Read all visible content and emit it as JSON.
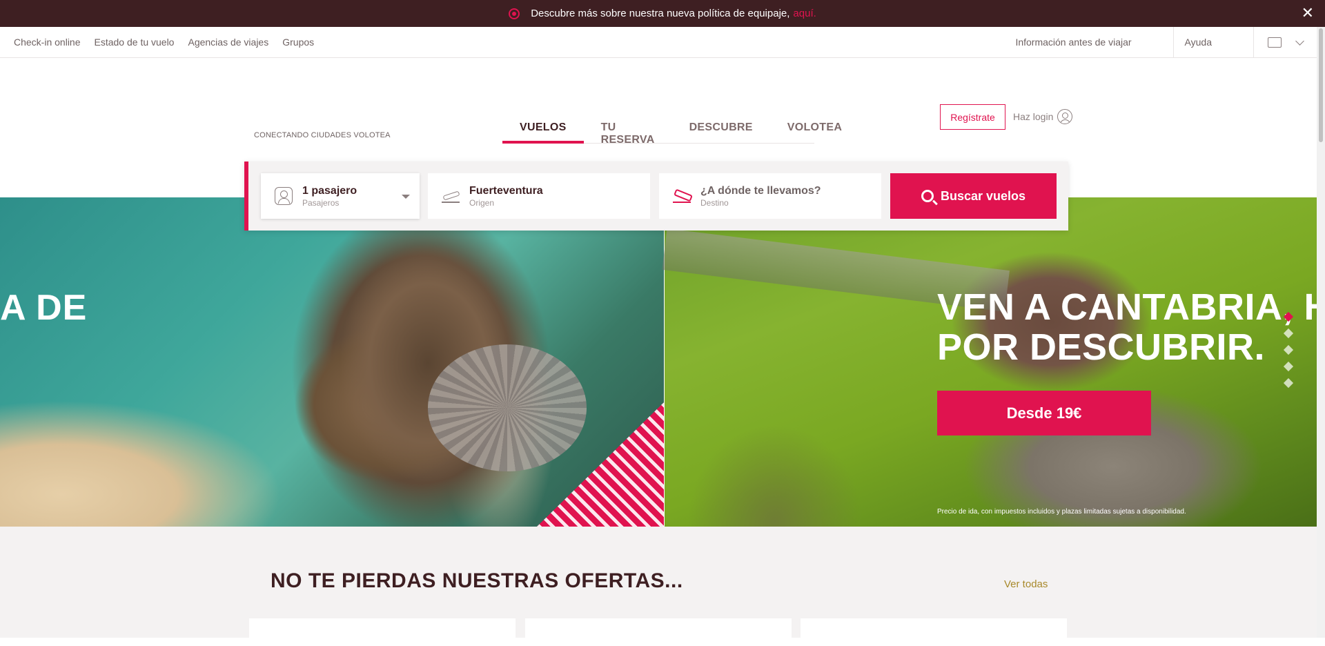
{
  "notice": {
    "text": "Descubre más sobre nuestra nueva política de equipaje,",
    "link": "aquí.",
    "close_icon": "close-icon"
  },
  "util_nav": {
    "left": [
      "Check-in online",
      "Estado de tu vuelo",
      "Agencias de viajes",
      "Grupos"
    ],
    "info": "Información antes de viajar",
    "help": "Ayuda"
  },
  "header": {
    "tagline": "CONECTANDO CIUDADES VOLOTEA",
    "tabs": [
      "VUELOS",
      "TU RESERVA",
      "DESCUBRE",
      "VOLOTEA"
    ],
    "register": "Regístrate",
    "login": "Haz login"
  },
  "search": {
    "passengers": {
      "value": "1 pasajero",
      "label": "Pasajeros"
    },
    "origin": {
      "value": "Fuerteventura",
      "label": "Origen"
    },
    "destination": {
      "placeholder": "¿A dónde te llevamos?",
      "label": "Destino"
    },
    "button": "Buscar vuelos"
  },
  "hero": {
    "left_title": "A DE",
    "right_title_1": "VEN A CANTABRIA, HAY MÁS",
    "right_title_2": "POR DESCUBRIR.",
    "cta": "Desde 19€",
    "disclaimer": "Precio de ida, con impuestos incluidos y plazas limitadas sujetas a disponibilidad.",
    "slides": 5,
    "active_slide": 1
  },
  "offers": {
    "title": "NO TE PIERDAS NUESTRAS OFERTAS...",
    "see_all": "Ver todas"
  },
  "colors": {
    "accent": "#e0134f",
    "dark": "#3e1f22",
    "gold": "#a8892a"
  }
}
